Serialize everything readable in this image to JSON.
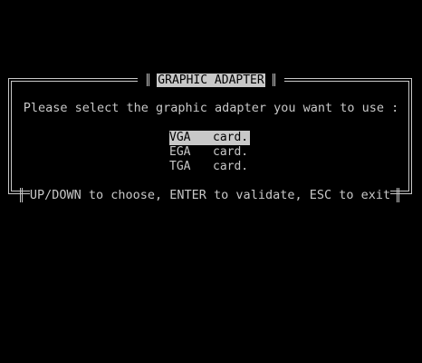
{
  "dialog": {
    "title": "GRAPHIC ADAPTER",
    "prompt": "Please select the graphic adapter you want to use :",
    "options": [
      {
        "name": "VGA",
        "suffix": "card.",
        "selected": true
      },
      {
        "name": "EGA",
        "suffix": "card.",
        "selected": false
      },
      {
        "name": "TGA",
        "suffix": "card.",
        "selected": false
      }
    ],
    "help": "UP/DOWN to choose, ENTER to validate, ESC to exit"
  },
  "colors": {
    "background": "#000000",
    "foreground": "#c8c8c8",
    "highlight_bg": "#c8c8c8",
    "highlight_fg": "#000000"
  }
}
